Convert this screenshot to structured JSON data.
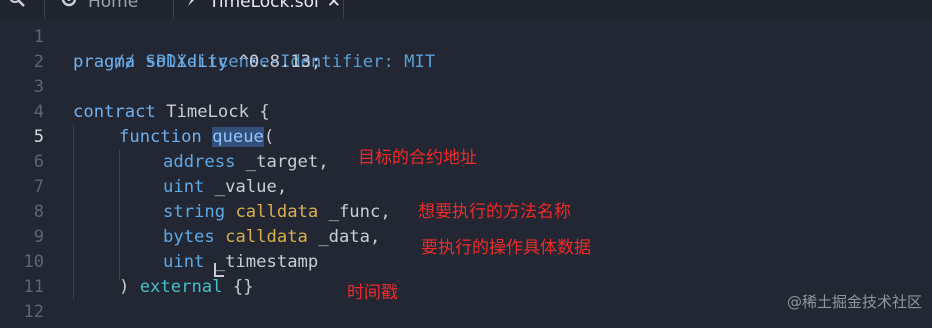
{
  "tabs": {
    "left_icon": "zoom-icon",
    "home_label": "Home",
    "file_label": "TimeLock.sol",
    "close_glyph": "✕"
  },
  "editor": {
    "active_line": 5,
    "line_numbers": [
      "1",
      "2",
      "3",
      "4",
      "5",
      "6",
      "7",
      "8",
      "9",
      "10",
      "11",
      "12"
    ]
  },
  "code": {
    "l1": "// SPDX-License-Identifier: MIT",
    "l2_kw": "pragma solidity",
    "l2_rest": " ^0.8.13;",
    "l4_kw": "contract",
    "l4_rest": " TimeLock {",
    "l5_kw": "function",
    "l5_name": "queue",
    "l5_rest": "(",
    "l6_type": "address",
    "l6_rest": " _target,",
    "l7_type": "uint",
    "l7_rest": " _value,",
    "l8_type": "string",
    "l8_loc": "calldata",
    "l8_rest": " _func,",
    "l9_type": "bytes",
    "l9_loc": "calldata",
    "l9_rest": " _data,",
    "l10_type": "uint",
    "l10_rest": " _timestamp",
    "l11_pre": ") ",
    "l11_kw": "external",
    "l11_rest": " {}"
  },
  "annotations": {
    "target": "目标的合约地址",
    "func": "想要执行的方法名称",
    "data": "要执行的操作具体数据",
    "timestamp": "时间戳"
  },
  "watermark": "@稀土掘金技术社区"
}
